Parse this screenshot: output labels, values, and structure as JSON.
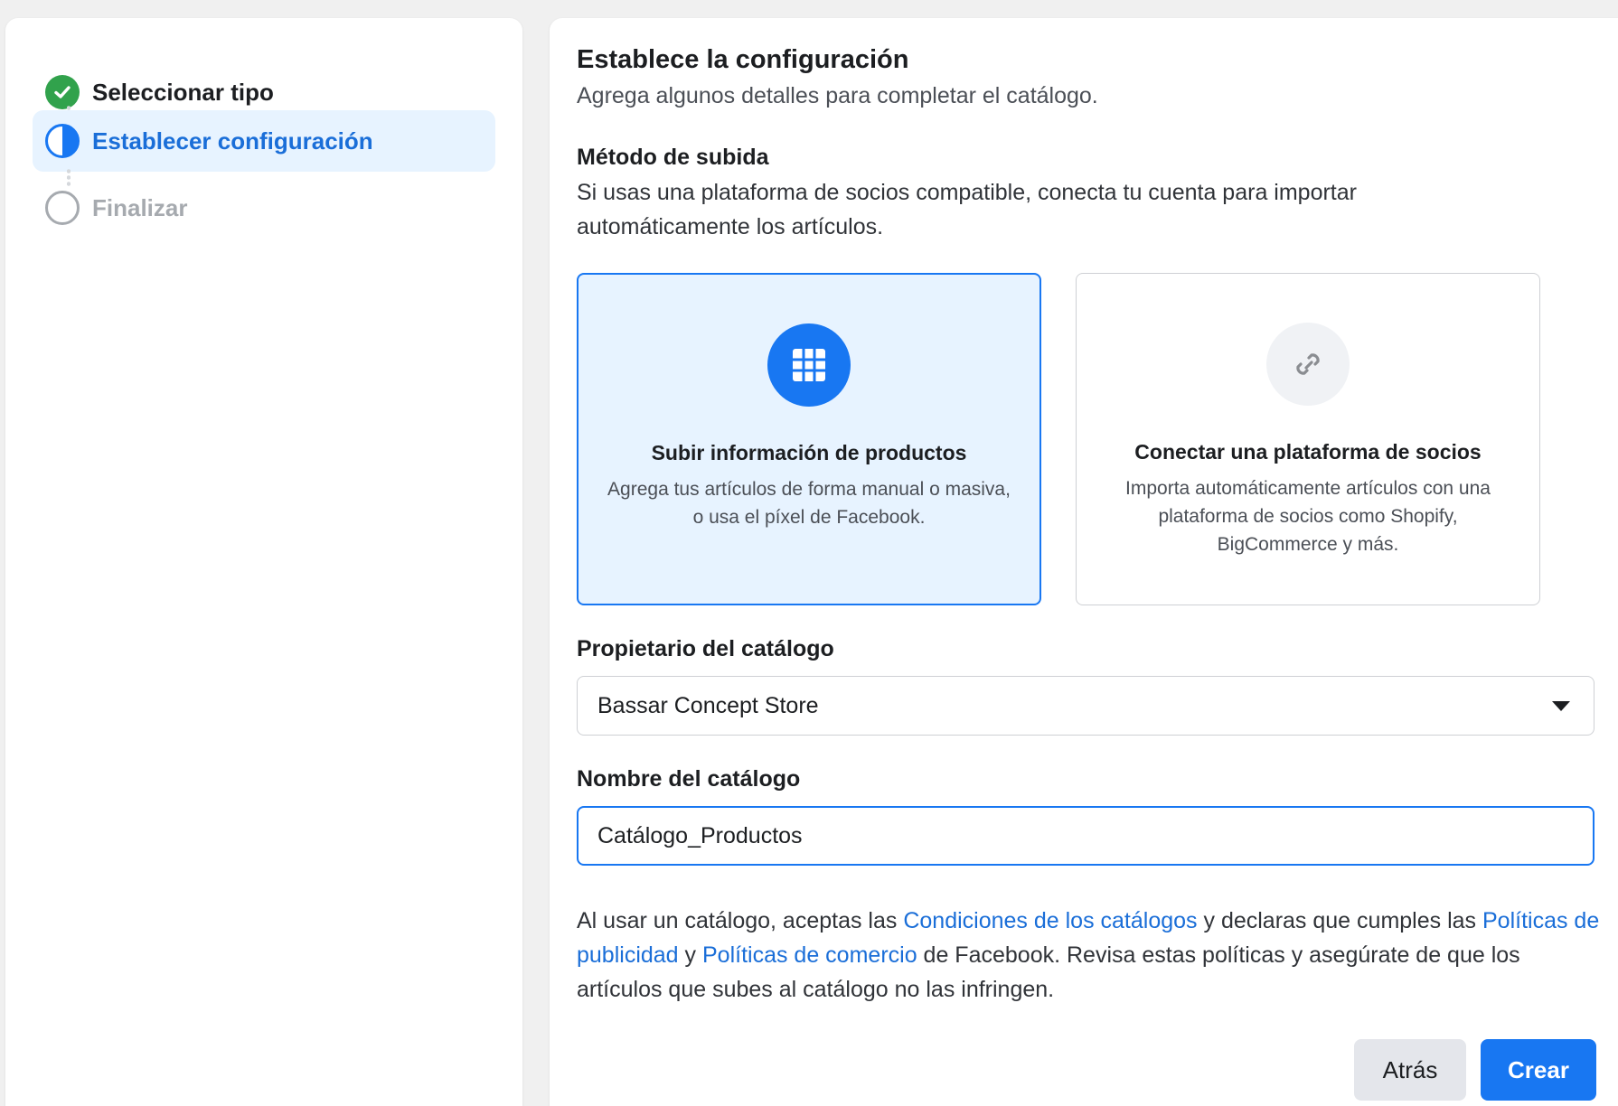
{
  "stepper": {
    "steps": [
      {
        "label": "Seleccionar tipo",
        "state": "done"
      },
      {
        "label": "Establecer configuración",
        "state": "active"
      },
      {
        "label": "Finalizar",
        "state": "pending"
      }
    ]
  },
  "main": {
    "title": "Establece la configuración",
    "subtitle": "Agrega algunos detalles para completar el catálogo.",
    "upload_method": {
      "heading": "Método de subida",
      "description": "Si usas una plataforma de socios compatible, conecta tu cuenta para importar automáticamente los artículos.",
      "options": [
        {
          "title": "Subir información de productos",
          "description": "Agrega tus artículos de forma manual o masiva, o usa el píxel de Facebook.",
          "icon": "grid-icon",
          "selected": true
        },
        {
          "title": "Conectar una plataforma de socios",
          "description": "Importa automáticamente artículos con una plataforma de socios como Shopify, BigCommerce y más.",
          "icon": "link-icon",
          "selected": false
        }
      ]
    },
    "owner": {
      "label": "Propietario del catálogo",
      "value": "Bassar Concept Store"
    },
    "catalog_name": {
      "label": "Nombre del catálogo",
      "value": "Catálogo_Productos"
    },
    "terms": {
      "part1": "Al usar un catálogo, aceptas las ",
      "link1": "Condiciones de los catálogos",
      "part2": " y declaras que cumples las ",
      "link2": "Políticas de publicidad",
      "part3": " y ",
      "link3": "Políticas de comercio",
      "part4": " de Facebook. Revisa estas políticas y asegúrate de que los artículos que subes al catálogo no las infringen."
    },
    "buttons": {
      "back": "Atrás",
      "create": "Crear"
    }
  },
  "colors": {
    "accent": "#1877f2",
    "success": "#31a24c",
    "selected_bg": "#e7f3ff"
  }
}
